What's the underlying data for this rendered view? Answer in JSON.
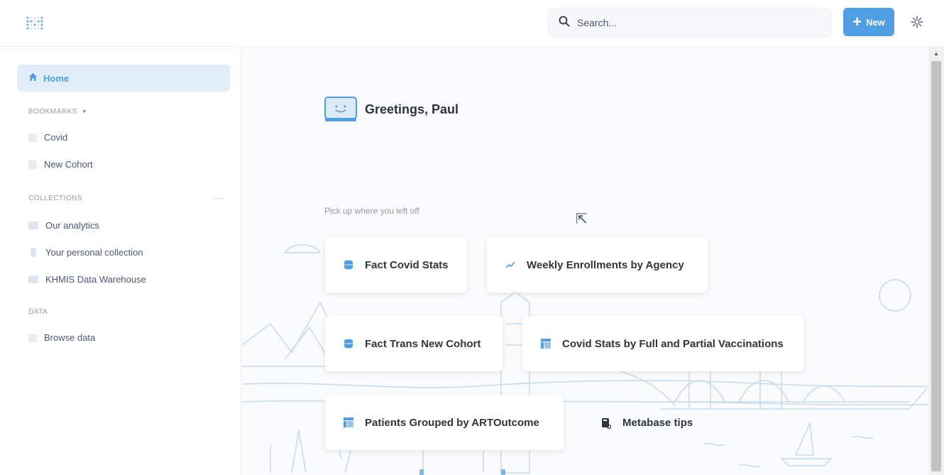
{
  "topbar": {
    "logo_icon": "metabase-logo-icon",
    "search": {
      "placeholder": "Search...",
      "icon": "search-icon"
    },
    "new_button": {
      "label": "New",
      "icon": "plus-icon",
      "color": "#509ee3"
    },
    "settings_icon": "gear-icon"
  },
  "sidebar": {
    "home": {
      "label": "Home",
      "icon": "home-icon"
    },
    "bookmarks": {
      "label": "BOOKMARKS",
      "items": [
        {
          "label": "Covid"
        },
        {
          "label": "New Cohort"
        }
      ]
    },
    "collections": {
      "label": "COLLECTIONS",
      "more": "···",
      "items": [
        {
          "label": "Our analytics"
        },
        {
          "label": "Your personal collection"
        },
        {
          "label": "KHMIS Data Warehouse"
        }
      ]
    },
    "data": {
      "label": "DATA",
      "items": [
        {
          "label": "Browse data"
        }
      ]
    }
  },
  "main": {
    "greeting": "Greetings, Paul",
    "pickup_label": "Pick up where you left off",
    "cards": [
      {
        "label": "Fact Covid Stats",
        "icon": "database-table-icon"
      },
      {
        "label": "Weekly Enrollments by Agency",
        "icon": "line-chart-icon"
      },
      {
        "label": "Fact Trans New Cohort",
        "icon": "database-table-icon"
      },
      {
        "label": "Covid Stats by Full and Partial Vaccinations",
        "icon": "pivot-table-icon"
      },
      {
        "label": "Patients Grouped by ARTOutcome",
        "icon": "pivot-table-icon"
      },
      {
        "label": "Metabase tips",
        "icon": "book-icon"
      }
    ]
  },
  "colors": {
    "brand": "#509ee3",
    "home_highlight": "#e1edf8",
    "text": "#4c5773",
    "heading": "#2e353b"
  }
}
